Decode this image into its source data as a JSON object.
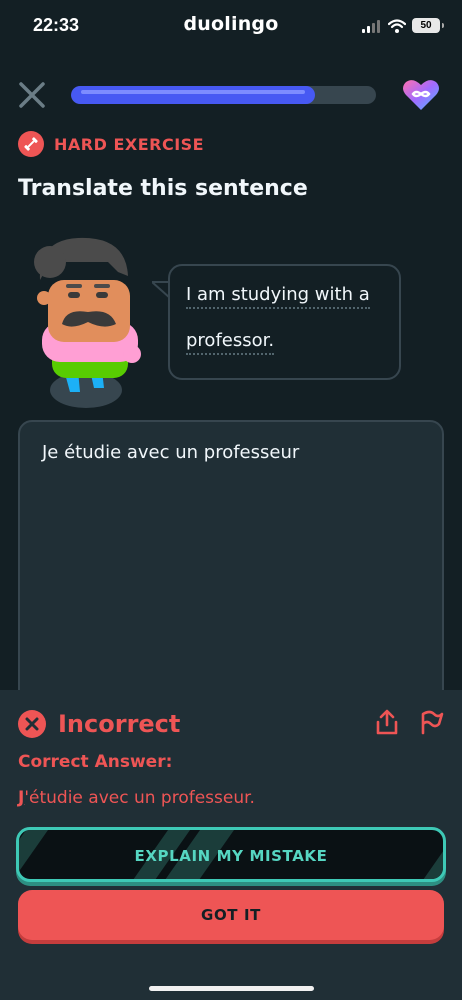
{
  "status_bar": {
    "time": "22:33",
    "app_name": "duolingo",
    "battery": "50"
  },
  "lesson": {
    "progress_percent": 80,
    "hearts_icon": "infinity-heart-icon"
  },
  "exercise": {
    "tag": "HARD EXERCISE",
    "title": "Translate this sentence",
    "prompt_line1": "I am studying with a",
    "prompt_line2": "professor.",
    "user_answer": "Je étudie avec un professeur"
  },
  "feedback": {
    "status": "Incorrect",
    "correct_heading": "Correct Answer:",
    "correct_first": "J",
    "correct_rest": "'étudie avec un professeur.",
    "explain_button": "EXPLAIN MY MISTAKE",
    "got_it_button": "GOT IT"
  },
  "colors": {
    "background": "#131f24",
    "error": "#ee5555",
    "accent_teal": "#56d6c2",
    "progress": "#4759f3"
  }
}
